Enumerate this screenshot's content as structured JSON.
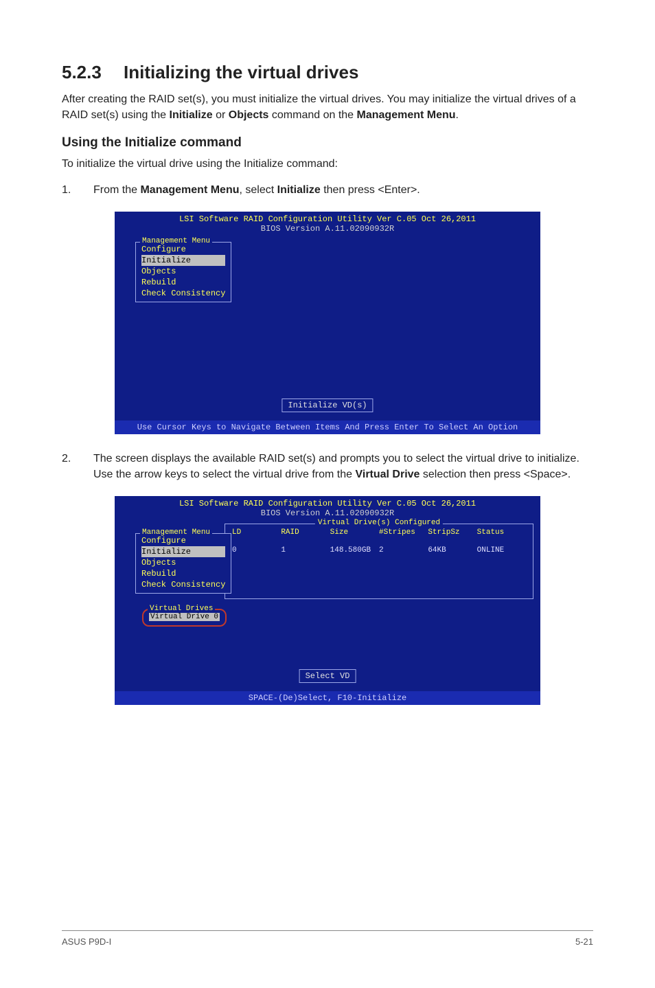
{
  "heading": {
    "number": "5.2.3",
    "title": "Initializing the virtual drives"
  },
  "intro": {
    "pre": "After creating the RAID set(s), you must initialize the virtual drives. You may initialize the virtual drives of a RAID set(s) using the ",
    "b1": "Initialize",
    "mid1": " or ",
    "b2": "Objects",
    "mid2": " command on the ",
    "b3": "Management Menu",
    "post": "."
  },
  "sub1": "Using the Initialize command",
  "sub1_text": "To initialize the virtual drive using the Initialize command:",
  "step1": {
    "n": "1.",
    "pre": "From the ",
    "b1": "Management Menu",
    "mid": ", select ",
    "b2": "Initialize",
    "post": " then press <Enter>."
  },
  "bios1": {
    "hdr1": "LSI Software RAID Configuration Utility Ver C.05 Oct 26,2011",
    "hdr2": "BIOS Version  A.11.02090932R",
    "menu_title": "Management Menu",
    "items": [
      "Configure",
      "Initialize",
      "Objects",
      "Rebuild",
      "Check Consistency"
    ],
    "selected": 1,
    "center": "Initialize VD(s)",
    "footer": "Use Cursor Keys to Navigate Between Items And Press Enter To Select An Option"
  },
  "step2": {
    "n": "2.",
    "pre": "The screen displays the available RAID set(s) and prompts you to select the virtual drive to initialize. Use the arrow keys to select the virtual drive from the ",
    "b1": "Virtual Drive",
    "post": " selection then press <Space>."
  },
  "bios2": {
    "hdr1": "LSI Software RAID Configuration Utility Ver C.05 Oct 26,2011",
    "hdr2": "BIOS Version  A.11.02090932R",
    "panel_title": "Virtual Drive(s) Configured",
    "cols": {
      "c0": "LD",
      "c1": "RAID",
      "c2": "Size",
      "c3": "#Stripes",
      "c4": "StripSz",
      "c5": "Status"
    },
    "row": {
      "c0": "0",
      "c1": "1",
      "c2": "148.580GB",
      "c3": "2",
      "c4": "64KB",
      "c5": "ONLINE"
    },
    "menu_title": "Management Menu",
    "items": [
      "Configure",
      "Initialize",
      "Objects",
      "Rebuild",
      "Check Consistency"
    ],
    "selected": 1,
    "vd_title": "Virtual Drives",
    "vd_item": "Virtual Drive 0",
    "center": "Select VD",
    "footer": "SPACE-(De)Select, F10-Initialize"
  },
  "footer": {
    "left": "ASUS P9D-I",
    "right": "5-21"
  }
}
